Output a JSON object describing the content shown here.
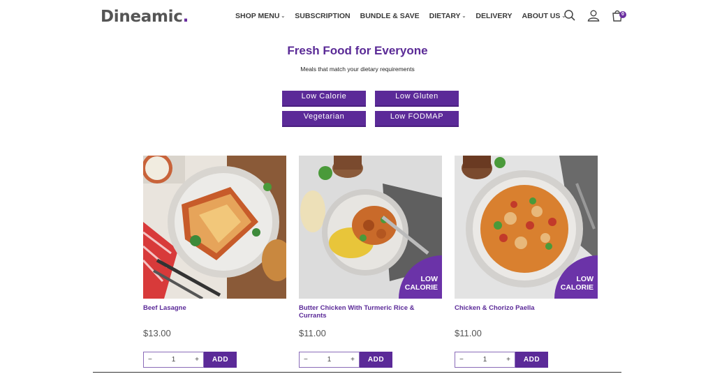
{
  "brand": {
    "name": "Dineamic",
    "dot": "."
  },
  "nav": [
    {
      "label": "SHOP MENU",
      "dropdown": true
    },
    {
      "label": "SUBSCRIPTION",
      "dropdown": false
    },
    {
      "label": "BUNDLE & SAVE",
      "dropdown": false
    },
    {
      "label": "DIETARY",
      "dropdown": true
    },
    {
      "label": "DELIVERY",
      "dropdown": false
    },
    {
      "label": "ABOUT US",
      "dropdown": true
    }
  ],
  "header": {
    "cart_count": "0",
    "icons": [
      "search-icon",
      "user-icon",
      "cart-icon"
    ]
  },
  "hero": {
    "title": "Fresh Food for Everyone",
    "subtitle": "Meals that match your dietary requirements"
  },
  "filters": {
    "low_calorie": "Low Calorie",
    "low_gluten": "Low Gluten",
    "vegetarian": "Vegetarian",
    "low_fodmap": "Low FODMAP"
  },
  "products": [
    {
      "name": "Beef Lasagne",
      "price": "$13.00",
      "qty": "1",
      "add": "ADD",
      "badge": ""
    },
    {
      "name": "Butter Chicken With Turmeric Rice & Currants",
      "price": "$11.00",
      "qty": "1",
      "add": "ADD",
      "badge_line1": "LOW",
      "badge_line2": "CALORIE"
    },
    {
      "name": "Chicken & Chorizo Paella",
      "price": "$11.00",
      "qty": "1",
      "add": "ADD",
      "badge_line1": "LOW",
      "badge_line2": "CALORIE"
    }
  ],
  "qty_controls": {
    "minus": "−",
    "plus": "+"
  },
  "colors": {
    "brand_purple": "#5b2a98",
    "badge_purple": "#6b33a8"
  }
}
